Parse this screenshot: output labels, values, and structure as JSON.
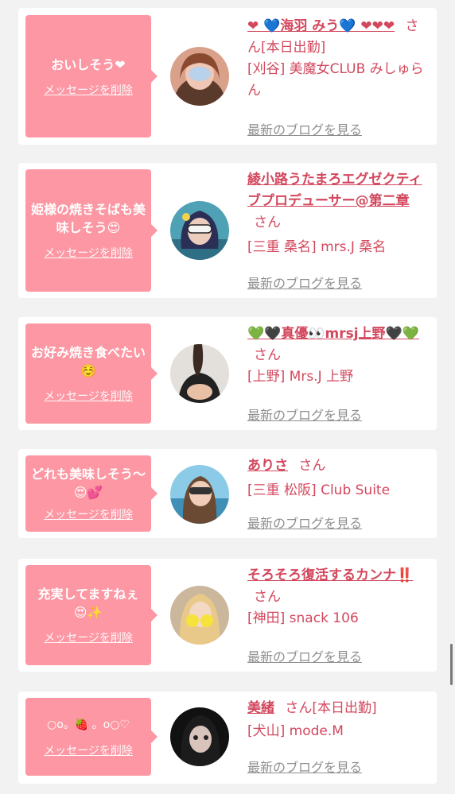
{
  "feed": [
    {
      "message": "おいしそう❤",
      "delete_label": "メッセージを削除",
      "name": "❤︎ 💙海羽 みう💙 ❤︎❤︎❤︎",
      "honorific": "さん",
      "status": "[本日出勤]",
      "shop": "[刈谷] 美魔女CLUB みしゅらん",
      "blog_label": "最新のブログを見る"
    },
    {
      "message": "姫様の焼きそばも美味しそう😍",
      "delete_label": "メッセージを削除",
      "name": "綾小路うたまろエグゼクティブプロデューサー@第二章",
      "honorific": "さん",
      "status": "",
      "shop": "[三重 桑名] mrs.J 桑名",
      "blog_label": "最新のブログを見る"
    },
    {
      "message": "お好み焼き食べたい☺️",
      "delete_label": "メッセージを削除",
      "name": "💚🖤真優👀mrsj上野🖤💚",
      "honorific": "さん",
      "status": "",
      "shop": "[上野] Mrs.J 上野",
      "blog_label": "最新のブログを見る"
    },
    {
      "message": "どれも美味しそう〜😍💕",
      "delete_label": "メッセージを削除",
      "name": "ありさ",
      "honorific": "さん",
      "status": "",
      "shop": "[三重 松阪] Club Suite",
      "blog_label": "最新のブログを見る"
    },
    {
      "message": "充実してますねぇ😍✨",
      "delete_label": "メッセージを削除",
      "name": "そろそろ復活するカンナ‼️",
      "honorific": "さん",
      "status": "",
      "shop": "[神田] snack 106",
      "blog_label": "最新のブログを見る"
    },
    {
      "message": "○o。🍓 。o○♡",
      "delete_label": "メッセージを削除",
      "name": "美緒",
      "honorific": "さん",
      "status": "[本日出勤]",
      "shop": "[犬山] mode.M",
      "blog_label": "最新のブログを見る"
    }
  ],
  "colors": {
    "accent": "#d3475d",
    "bubble": "#fc97a3",
    "muted": "#8e8e8e",
    "background": "#f2f2f2"
  }
}
